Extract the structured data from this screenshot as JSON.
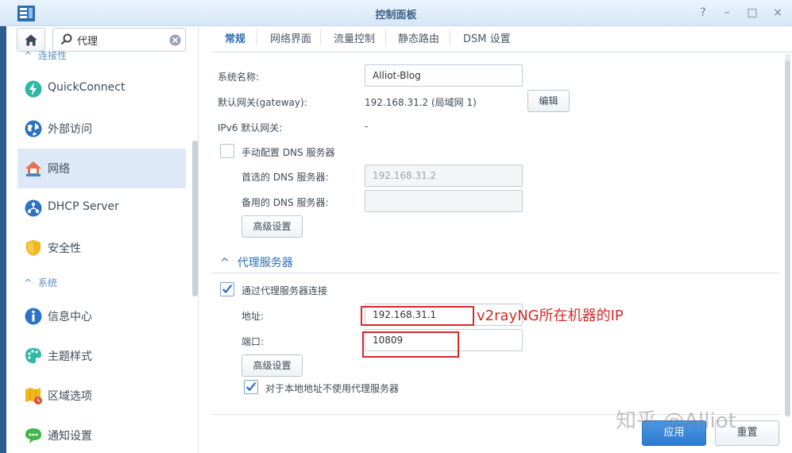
{
  "window": {
    "title": "控制面板",
    "controls": [
      "?",
      "–",
      "□",
      "×"
    ]
  },
  "sidebar": {
    "search_value": "代理",
    "section_connectivity": "连接性",
    "section_system": "系统",
    "items": [
      {
        "label": "QuickConnect",
        "icon": "quickconnect-icon"
      },
      {
        "label": "外部访问",
        "icon": "globe-icon"
      },
      {
        "label": "网络",
        "icon": "network-house-icon"
      },
      {
        "label": "DHCP Server",
        "icon": "dhcp-icon"
      },
      {
        "label": "安全性",
        "icon": "shield-icon"
      },
      {
        "label": "信息中心",
        "icon": "info-icon"
      },
      {
        "label": "主题样式",
        "icon": "palette-icon"
      },
      {
        "label": "区域选项",
        "icon": "region-icon"
      },
      {
        "label": "通知设置",
        "icon": "chat-icon"
      }
    ]
  },
  "tabs": [
    "常规",
    "网络界面",
    "流量控制",
    "静态路由",
    "DSM 设置"
  ],
  "general": {
    "system_name_label": "系统名称:",
    "system_name_value": "Alliot-Blog",
    "gateway_label": "默认网关(gateway):",
    "gateway_value": "192.168.31.2 (局域网 1)",
    "edit_button": "编辑",
    "ipv6_gateway_label": "IPv6 默认网关:",
    "ipv6_gateway_value": "-",
    "manual_dns_label": "手动配置 DNS 服务器",
    "preferred_dns_label": "首选的 DNS 服务器:",
    "preferred_dns_value": "192.168.31.2",
    "alternate_dns_label": "备用的 DNS 服务器:",
    "alternate_dns_value": "",
    "advanced_button": "高级设置"
  },
  "proxy": {
    "section_title": "代理服务器",
    "use_proxy_label": "通过代理服务器连接",
    "use_proxy_checked": true,
    "address_label": "地址:",
    "address_value": "192.168.31.1",
    "port_label": "端口:",
    "port_value": "10809",
    "advanced_button": "高级设置",
    "bypass_local_label": "对于本地地址不使用代理服务器",
    "bypass_local_checked": true
  },
  "annotation": {
    "text": "v2rayNG所在机器的IP",
    "color": "#d52a2a"
  },
  "footer": {
    "apply_button": "应用",
    "reset_button": "重置"
  },
  "watermark": "知乎 @Alliot",
  "colors": {
    "accent": "#2d6db3",
    "sidebar_active": "#dde9f6",
    "apply_button": "#3a86d8"
  }
}
